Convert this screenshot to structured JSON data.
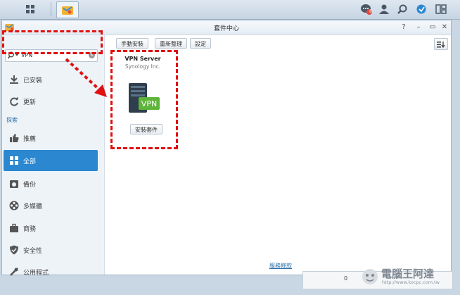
{
  "window": {
    "title": "套件中心"
  },
  "search": {
    "value": "VPN"
  },
  "sidebar": {
    "items": [
      {
        "label": "已安裝"
      },
      {
        "label": "更新"
      },
      {
        "label": "推薦"
      },
      {
        "label": "全部"
      },
      {
        "label": "備份"
      },
      {
        "label": "多媒體"
      },
      {
        "label": "商務"
      },
      {
        "label": "安全性"
      },
      {
        "label": "公用程式"
      }
    ],
    "section_explore": "探索"
  },
  "toolbar": {
    "manual_install": "手動安裝",
    "refresh": "重新整理",
    "settings": "設定"
  },
  "package": {
    "name": "VPN Server",
    "vendor": "Synology Inc.",
    "icon_text": "VPN",
    "install_label": "安裝套件"
  },
  "footer": {
    "terms": "服務條款"
  },
  "status": {
    "count": "0"
  },
  "notifications": {
    "badge": "8"
  },
  "watermark": {
    "brand": "電腦王阿達",
    "url": "http://www.kocpc.com.tw"
  },
  "colors": {
    "accent": "#2a87d0",
    "highlight": "#e01010",
    "vpn_green": "#5fb43a"
  }
}
